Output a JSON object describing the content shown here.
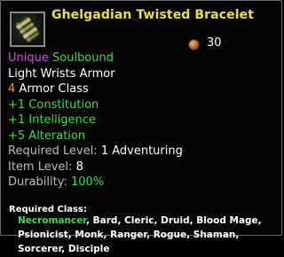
{
  "item": {
    "name": "Ghelgadian Twisted Bracelet",
    "icon": "bracelet-icon",
    "price": "30",
    "currency_icon": "copper-coin-icon",
    "tier": "Unique",
    "bound": "Soulbound",
    "type": "Light Wrists Armor",
    "armor_value": "4",
    "armor_label": "Armor Class",
    "stats": [
      "+1 Constitution",
      "+1 Intelligence",
      "+5 Alteration"
    ],
    "required_level_label": "Required Level:",
    "required_level_value": "1 Adventuring",
    "item_level_label": "Item Level:",
    "item_level_value": "8",
    "durability_label": "Durability:",
    "durability_value": "100%",
    "required_class_label": "Required Class:",
    "classes_highlight": "Necromancer",
    "classes_line1_rest": ", Bard, Cleric, Druid, Blood Mage,",
    "classes_line2": "Psionicist, Monk, Ranger, Rogue, Shaman,",
    "classes_line3": "Sorcerer, Disciple"
  },
  "colors": {
    "title": "#e8e14a",
    "tier": "#c85ad6",
    "bound": "#3fd94e",
    "stat": "#3fd94e",
    "armor_value": "#e49a2a",
    "label_grey": "#bdbdbd",
    "highlight_class": "#3fd94e"
  }
}
